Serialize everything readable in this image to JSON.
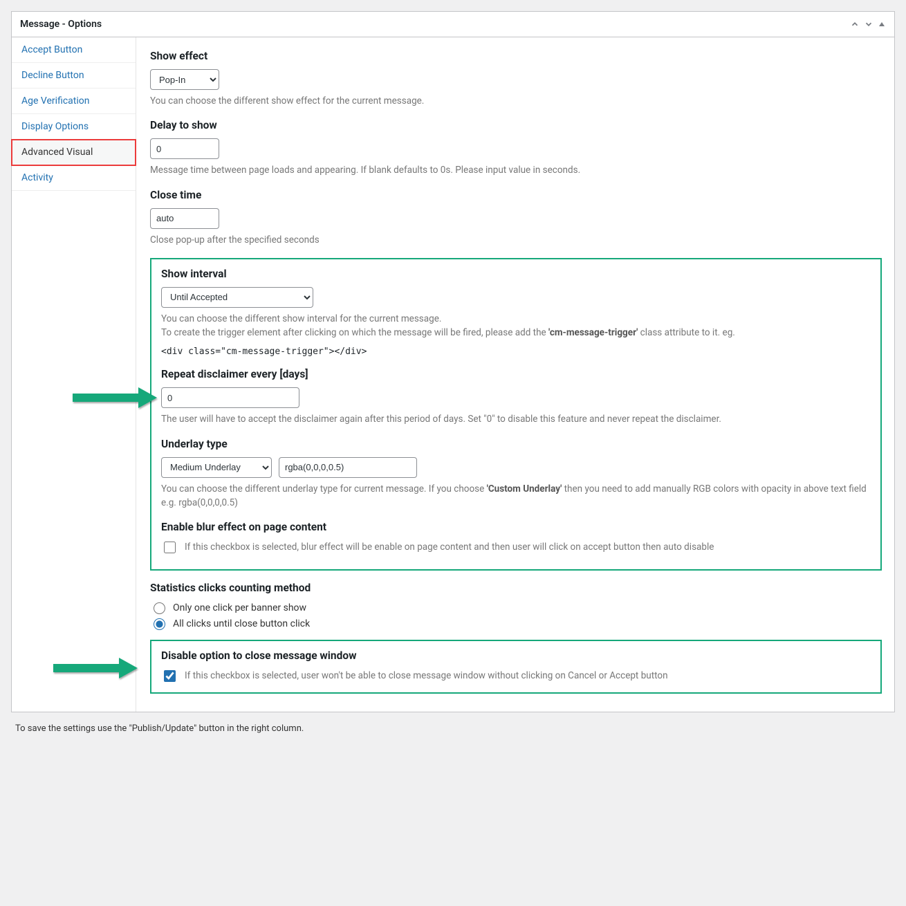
{
  "panel": {
    "title": "Message - Options"
  },
  "sidebar": {
    "items": [
      {
        "label": "Accept Button"
      },
      {
        "label": "Decline Button"
      },
      {
        "label": "Age Verification"
      },
      {
        "label": "Display Options"
      },
      {
        "label": "Advanced Visual"
      },
      {
        "label": "Activity"
      }
    ]
  },
  "sections": {
    "show_effect": {
      "title": "Show effect",
      "value": "Pop-In",
      "help": "You can choose the different show effect for the current message."
    },
    "delay": {
      "title": "Delay to show",
      "value": "0",
      "help": "Message time between page loads and appearing. If blank defaults to 0s. Please input value in seconds."
    },
    "close_time": {
      "title": "Close time",
      "value": "auto",
      "help": "Close pop-up after the specified seconds"
    },
    "show_interval": {
      "title": "Show interval",
      "value": "Until Accepted",
      "help1": "You can choose the different show interval for the current message.",
      "help2a": "To create the trigger element after clicking on which the message will be fired, please add the ",
      "help2b": "'cm-message-trigger'",
      "help2c": " class attribute to it. eg.",
      "code": "<div class=\"cm-message-trigger\"></div>"
    },
    "repeat": {
      "title": "Repeat disclaimer every [days]",
      "value": "0",
      "help": "The user will have to accept the disclaimer again after this period of days. Set \"0\" to disable this feature and never repeat the disclaimer."
    },
    "underlay": {
      "title": "Underlay type",
      "select_value": "Medium Underlay",
      "color_value": "rgba(0,0,0,0.5)",
      "help1": "You can choose the different underlay type for current message. If you choose ",
      "help1b": "'Custom Underlay'",
      "help1c": " then you need to add manually RGB colors with opacity in above text field e.g. rgba(0,0,0,0.5)"
    },
    "blur": {
      "title": "Enable blur effect on page content",
      "label": "If this checkbox is selected, blur effect will be enable on page content and then user will click on accept button then auto disable"
    },
    "stats": {
      "title": "Statistics clicks counting method",
      "opt1": "Only one click per banner show",
      "opt2": "All clicks until close button click"
    },
    "disable_close": {
      "title": "Disable option to close message window",
      "label": "If this checkbox is selected, user won't be able to close message window without clicking on Cancel or Accept button"
    }
  },
  "footer": {
    "note": "To save the settings use the \"Publish/Update\" button in the right column."
  }
}
